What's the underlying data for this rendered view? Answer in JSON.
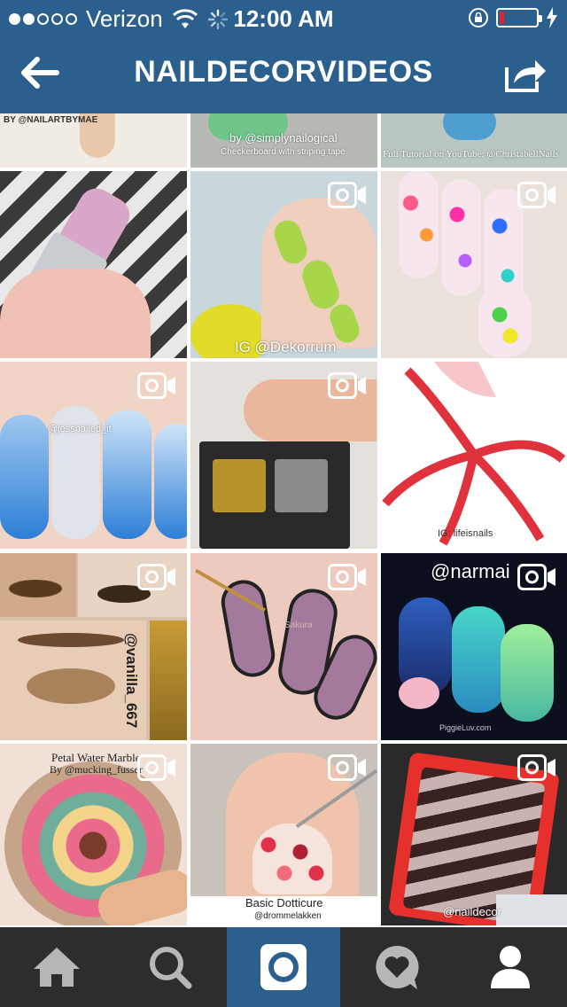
{
  "status_bar": {
    "carrier": "Verizon",
    "time": "12:00 AM",
    "signal_strength": 2,
    "battery_level": 0.12,
    "colors": {
      "battery_low": "#e4242c"
    }
  },
  "nav": {
    "title": "NAILDECORVIDEOS",
    "back_icon": "back-arrow-icon",
    "share_icon": "share-icon",
    "bar_color": "#2b5f8e"
  },
  "grid": {
    "top_row_captions": {
      "left": "BY @NAILARTBYMAE",
      "middle_line1": "by @simplynailogical",
      "middle_line2": "Checkerboard with striping tape",
      "right": "Full Tutorial on YouTube: @ChristabellNails"
    },
    "tiles": [
      {
        "caption": ""
      },
      {
        "caption": "IG @Dekorrum"
      },
      {
        "caption": ""
      },
      {
        "caption": "@jessnailed_it"
      },
      {
        "caption": ""
      },
      {
        "caption": "IG: lifeisnails"
      },
      {
        "caption": "@vanilla_667"
      },
      {
        "caption": "Sakura"
      },
      {
        "caption": "@narmai"
      },
      {
        "caption": "Petal Water Marble"
      },
      {
        "caption": "Basic Dotticure"
      },
      {
        "caption": "@naildecor"
      }
    ],
    "tile_extra": {
      "marble_sub": "By @mucking_fusser",
      "dotticure_sub": "@drommelakken",
      "piggie": "PiggieLuv.com"
    }
  },
  "tabbar": {
    "tabs": [
      {
        "icon": "home-icon"
      },
      {
        "icon": "search-icon"
      },
      {
        "icon": "camera-icon",
        "active": true
      },
      {
        "icon": "activity-heart-icon"
      },
      {
        "icon": "profile-icon"
      }
    ],
    "colors": {
      "background": "#2d2d2d",
      "active": "#2b5f8e"
    }
  }
}
